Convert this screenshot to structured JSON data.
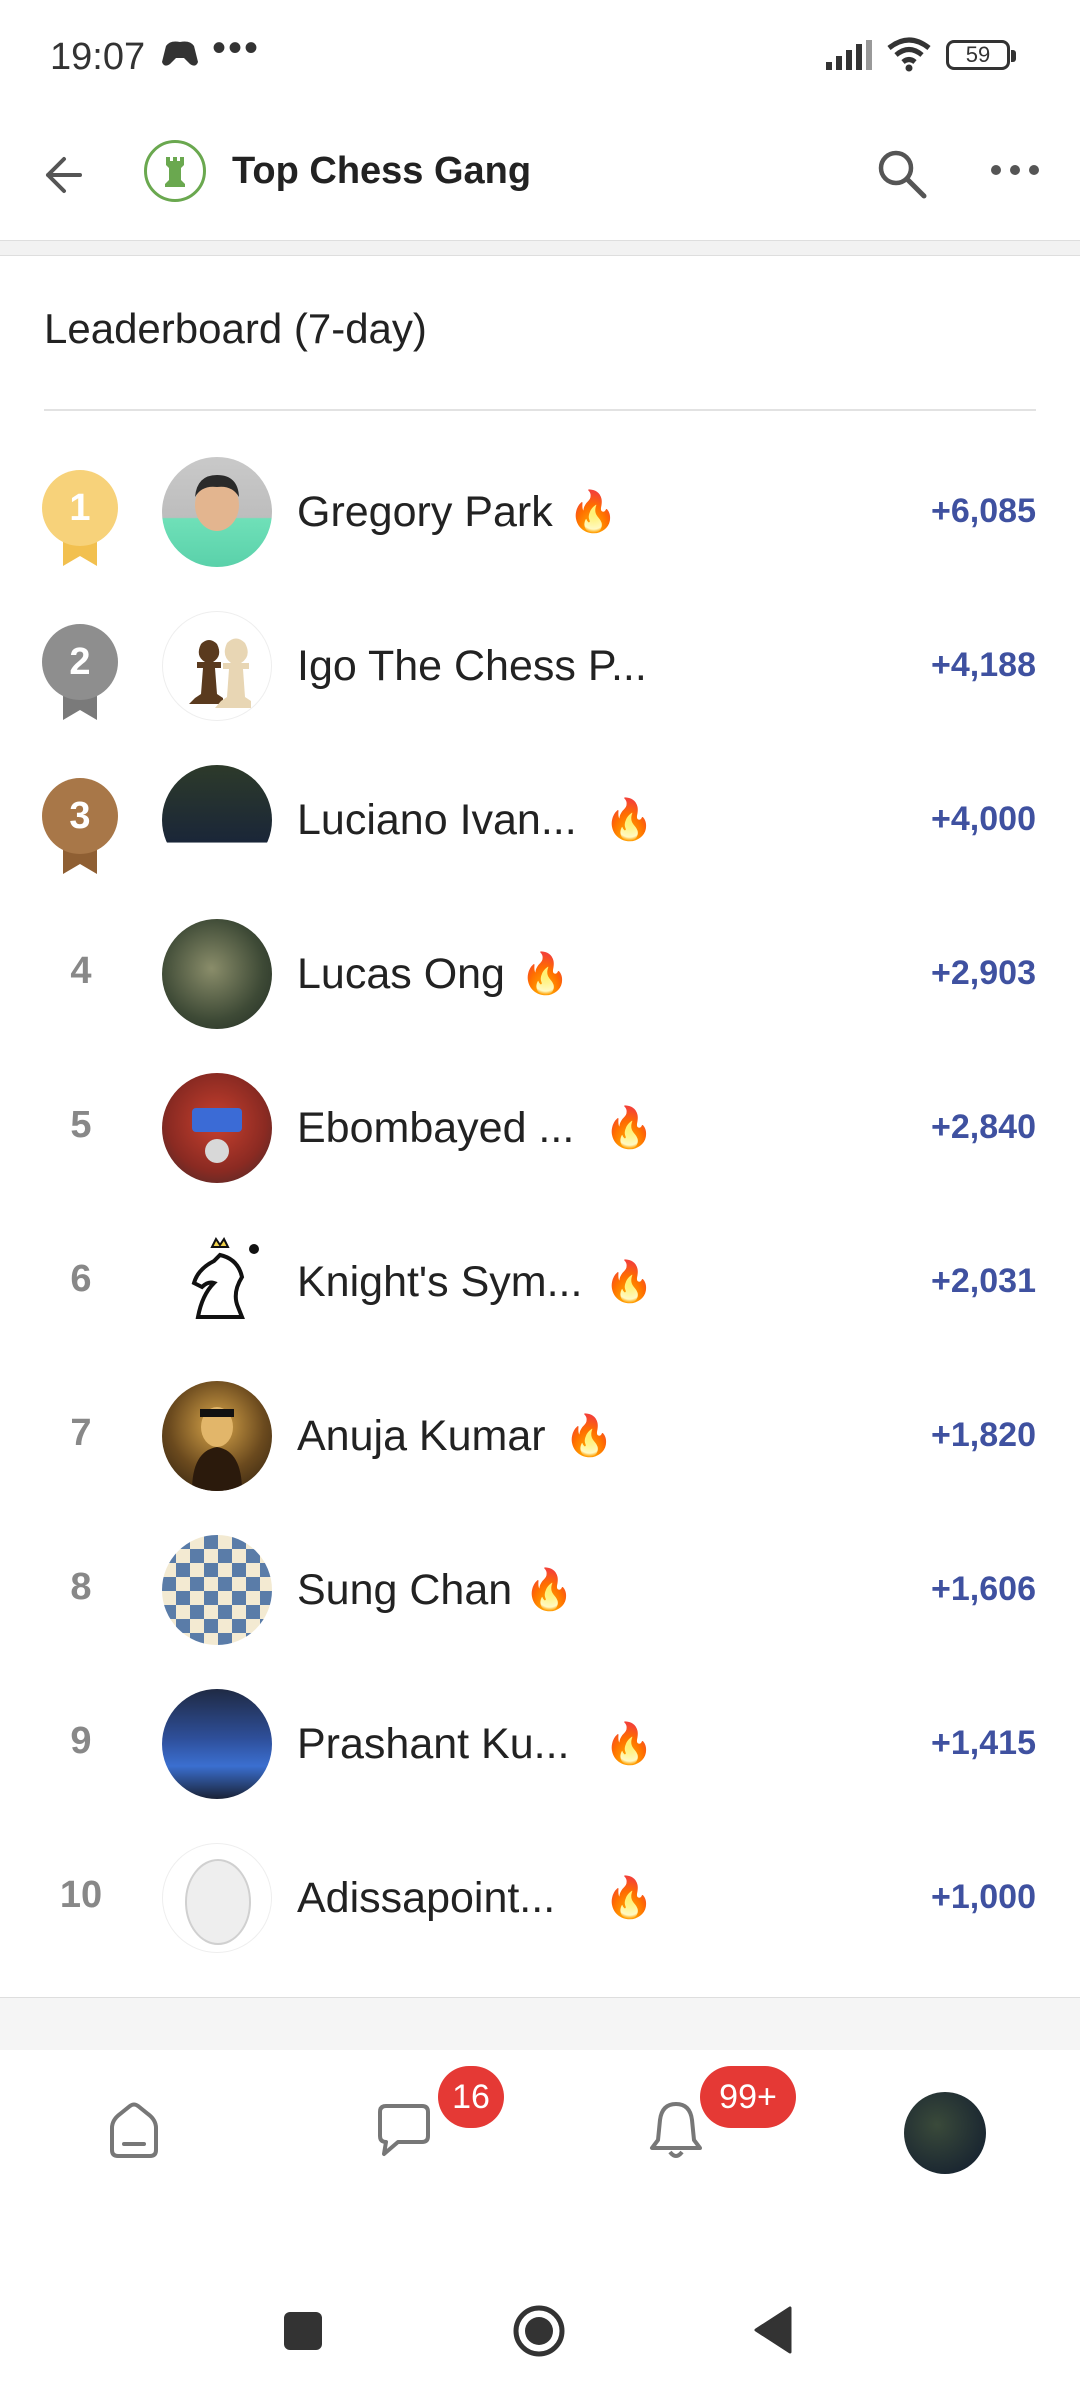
{
  "status_bar": {
    "time": "19:07",
    "dots": "•••",
    "battery": "59",
    "icons": [
      "gamepad-icon",
      "signal-icon",
      "wifi-icon",
      "battery-icon"
    ]
  },
  "header": {
    "title": "Top Chess Gang",
    "icons": [
      "back-arrow-icon",
      "search-icon",
      "more-icon"
    ]
  },
  "leaderboard": {
    "title": "Leaderboard (7-day)",
    "rows": [
      {
        "rank": "1",
        "name": "Gregory Park",
        "streak": true,
        "points": "+6,085"
      },
      {
        "rank": "2",
        "name": "Igo The Chess P...",
        "streak": false,
        "points": "+4,188"
      },
      {
        "rank": "3",
        "name": "Luciano Ivan...",
        "streak": true,
        "points": "+4,000"
      },
      {
        "rank": "4",
        "name": "Lucas Ong",
        "streak": true,
        "points": "+2,903"
      },
      {
        "rank": "5",
        "name": "Ebombayed ...",
        "streak": true,
        "points": "+2,840"
      },
      {
        "rank": "6",
        "name": "Knight's Sym...",
        "streak": true,
        "points": "+2,031"
      },
      {
        "rank": "7",
        "name": "Anuja Kumar",
        "streak": true,
        "points": "+1,820"
      },
      {
        "rank": "8",
        "name": "Sung Chan",
        "streak": true,
        "points": "+1,606"
      },
      {
        "rank": "9",
        "name": "Prashant Ku...",
        "streak": true,
        "points": "+1,415"
      },
      {
        "rank": "10",
        "name": "Adissapoint...",
        "streak": true,
        "points": "+1,000"
      }
    ],
    "fire": "🔥",
    "colors": {
      "gold": "#f7d27a",
      "silver": "#8e8e8e",
      "bronze": "#a87748",
      "points": "#3f51a0"
    }
  },
  "bottom_nav": {
    "chat_badge": "16",
    "notifications_badge": "99+",
    "icons": [
      "home-icon",
      "chat-icon",
      "bell-icon",
      "profile-avatar"
    ]
  },
  "system_nav": {
    "icons": [
      "recents-icon",
      "home-circle-icon",
      "back-triangle-icon"
    ]
  }
}
